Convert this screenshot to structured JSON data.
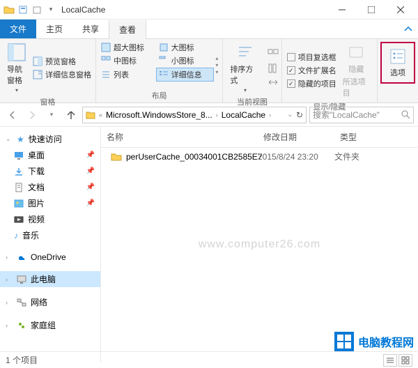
{
  "window": {
    "title": "LocalCache"
  },
  "tabs": {
    "file": "文件",
    "home": "主页",
    "share": "共享",
    "view": "查看"
  },
  "ribbon": {
    "group_panes": "窗格",
    "nav_pane": "导航窗格",
    "preview_pane": "预览窗格",
    "details_pane": "详细信息窗格",
    "group_layout": "布局",
    "xl_icons": "超大图标",
    "l_icons": "大图标",
    "m_icons": "中图标",
    "s_icons": "小图标",
    "list": "列表",
    "details": "详细信息",
    "group_current": "当前视图",
    "sort_by": "排序方式",
    "group_showhide": "显示/隐藏",
    "item_checkboxes": "项目复选框",
    "file_ext": "文件扩展名",
    "hidden_items": "隐藏的项目",
    "hide": "隐藏",
    "selected": "所选项目",
    "options": "选项"
  },
  "address": {
    "seg1": "Microsoft.WindowsStore_8...",
    "seg2": "LocalCache",
    "refresh": "↻"
  },
  "search": {
    "placeholder": "搜索\"LocalCache\""
  },
  "sidebar": {
    "quick": "快速访问",
    "desktop": "桌面",
    "downloads": "下载",
    "documents": "文档",
    "pictures": "图片",
    "videos": "视频",
    "music": "音乐",
    "onedrive": "OneDrive",
    "thispc": "此电脑",
    "network": "网络",
    "homegroup": "家庭组"
  },
  "columns": {
    "name": "名称",
    "date": "修改日期",
    "type": "类型"
  },
  "files": [
    {
      "name": "perUserCache_00034001CB2585E7",
      "date": "2015/8/24 23:20",
      "type": "文件夹"
    }
  ],
  "status": {
    "count": "1 个项目"
  },
  "watermark": "www.computer26.com",
  "brand": {
    "text": "电脑教程网"
  }
}
